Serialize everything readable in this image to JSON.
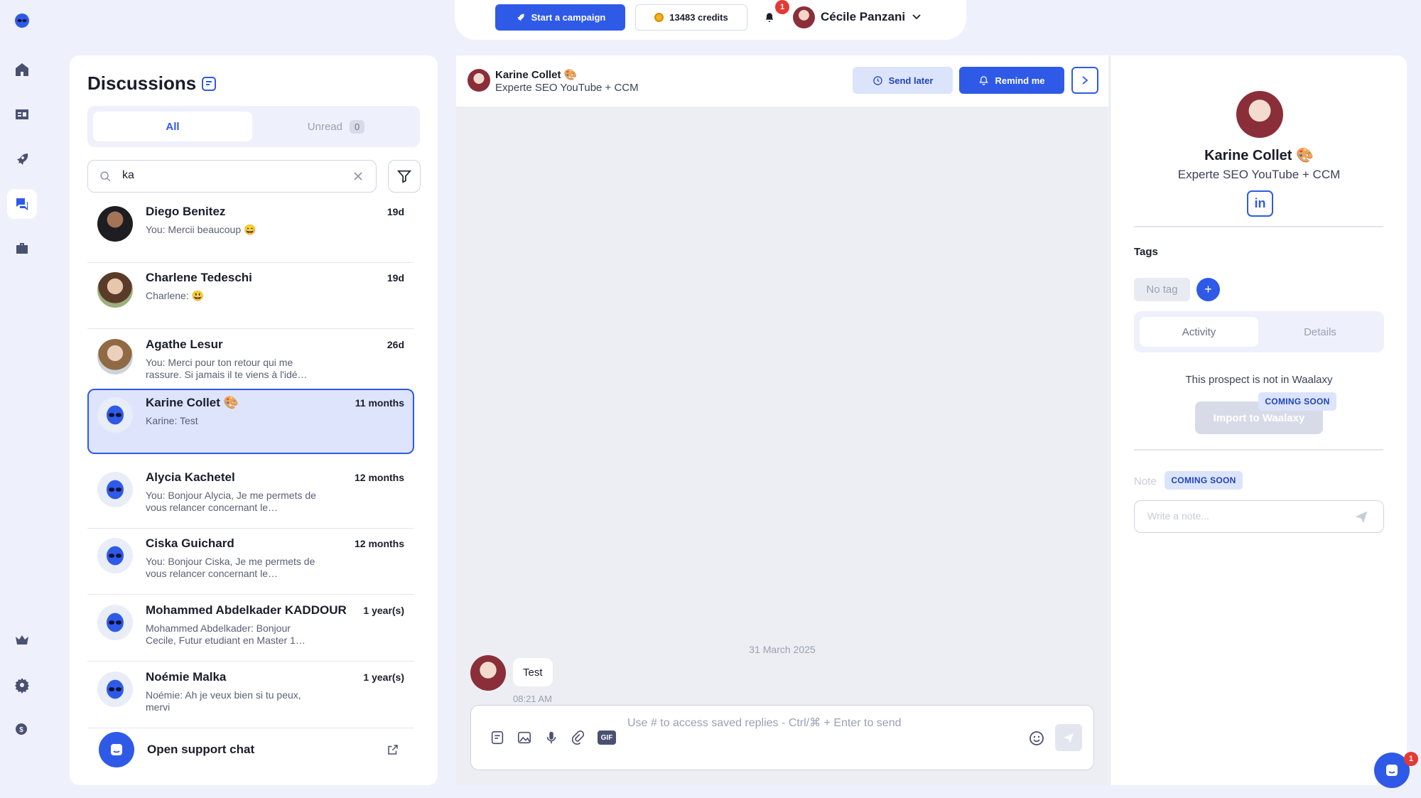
{
  "topbar": {
    "start_campaign": "Start a campaign",
    "credits": "13483 credits",
    "notification_count": "1",
    "user_name": "Cécile Panzani"
  },
  "discussions": {
    "title": "Discussions",
    "tab_all": "All",
    "tab_unread": "Unread",
    "unread_count": "0",
    "search_value": "ka",
    "conversations": [
      {
        "name": "Diego Benitez",
        "time": "19d",
        "preview": "You: Mercii beaucoup 😄"
      },
      {
        "name": "Charlene Tedeschi",
        "time": "19d",
        "preview": "Charlene: 😃"
      },
      {
        "name": "Agathe Lesur",
        "time": "26d",
        "preview": "You: Merci pour ton retour qui me rassure. Si jamais il te viens à l'idé…"
      },
      {
        "name": "Karine Collet 🎨",
        "time": "11 months",
        "preview": "Karine: Test"
      },
      {
        "name": "Alycia Kachetel",
        "time": "12 months",
        "preview": "You: Bonjour Alycia, Je me permets de vous relancer concernant le…"
      },
      {
        "name": "Ciska Guichard",
        "time": "12 months",
        "preview": "You: Bonjour Ciska, Je me permets de vous relancer concernant le…"
      },
      {
        "name": "Mohammed Abdelkader KADDOUR",
        "time": "1 year(s)",
        "preview": "Mohammed Abdelkader: Bonjour Cecile, Futur etudiant en Master 1…"
      },
      {
        "name": "Noémie Malka",
        "time": "1 year(s)",
        "preview": "Noémie: Ah je veux bien si tu peux, mervi"
      }
    ],
    "support_label": "Open support chat"
  },
  "chat": {
    "contact_name": "Karine Collet 🎨",
    "contact_title": "Experte SEO YouTube + CCM",
    "send_later": "Send later",
    "remind_me": "Remind me",
    "date_divider": "31 March 2025",
    "message_text": "Test",
    "message_time": "08:21 AM",
    "composer_placeholder": "Use # to access saved replies - Ctrl/⌘ + Enter to send",
    "gif_label": "GIF"
  },
  "profile": {
    "name": "Karine Collet 🎨",
    "title": "Experte SEO YouTube + CCM",
    "linkedin_label": "in",
    "tags_heading": "Tags",
    "no_tag": "No tag",
    "add_tag": "+",
    "tab_activity": "Activity",
    "tab_details": "Details",
    "not_in_waalaxy": "This prospect is not in Waalaxy",
    "import_label": "Import to Waalaxy",
    "coming_soon": "COMING SOON",
    "note_label": "Note",
    "note_placeholder": "Write a note..."
  },
  "support_fab_count": "1"
}
